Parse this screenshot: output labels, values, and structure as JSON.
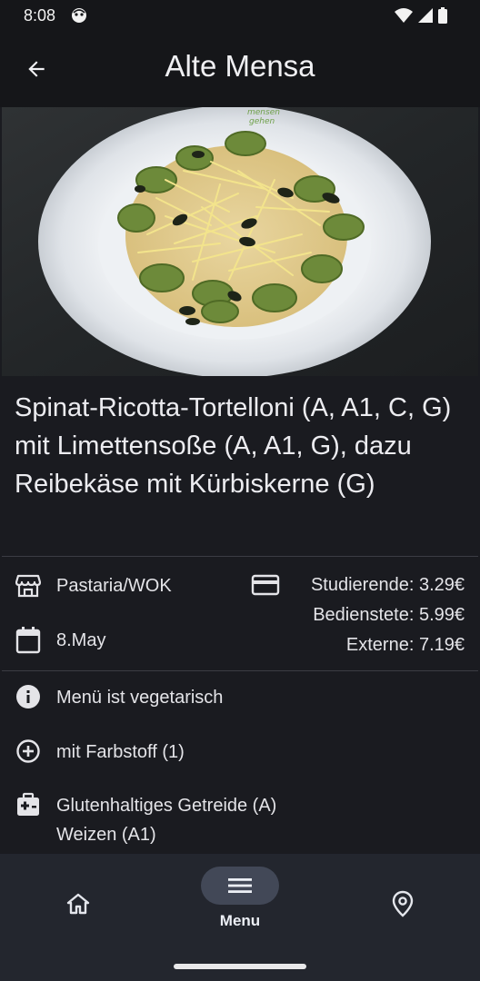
{
  "status_bar": {
    "time": "8:08"
  },
  "app_bar": {
    "title": "Alte Mensa"
  },
  "dish": {
    "title": "Spinat-Ricotta-Tortelloni (A, A1, C, G) mit Limettensoße (A, A1, G), dazu Reibekäse mit Kürbiskerne (G)"
  },
  "details": {
    "location": "Pastaria/WOK",
    "date": "8.May",
    "prices": [
      "Studierende: 3.29€",
      "Bedienstete: 5.99€",
      "Externe: 7.19€"
    ]
  },
  "notes": {
    "vegetarian": "Menü ist vegetarisch",
    "additive": "mit Farbstoff (1)",
    "allergens": [
      "Glutenhaltiges Getreide (A)",
      "Weizen (A1)"
    ]
  },
  "nav": {
    "menu_label": "Menu"
  },
  "colors": {
    "background": "#1a1b20",
    "nav_background": "#23262e",
    "nav_pill": "#424857"
  }
}
